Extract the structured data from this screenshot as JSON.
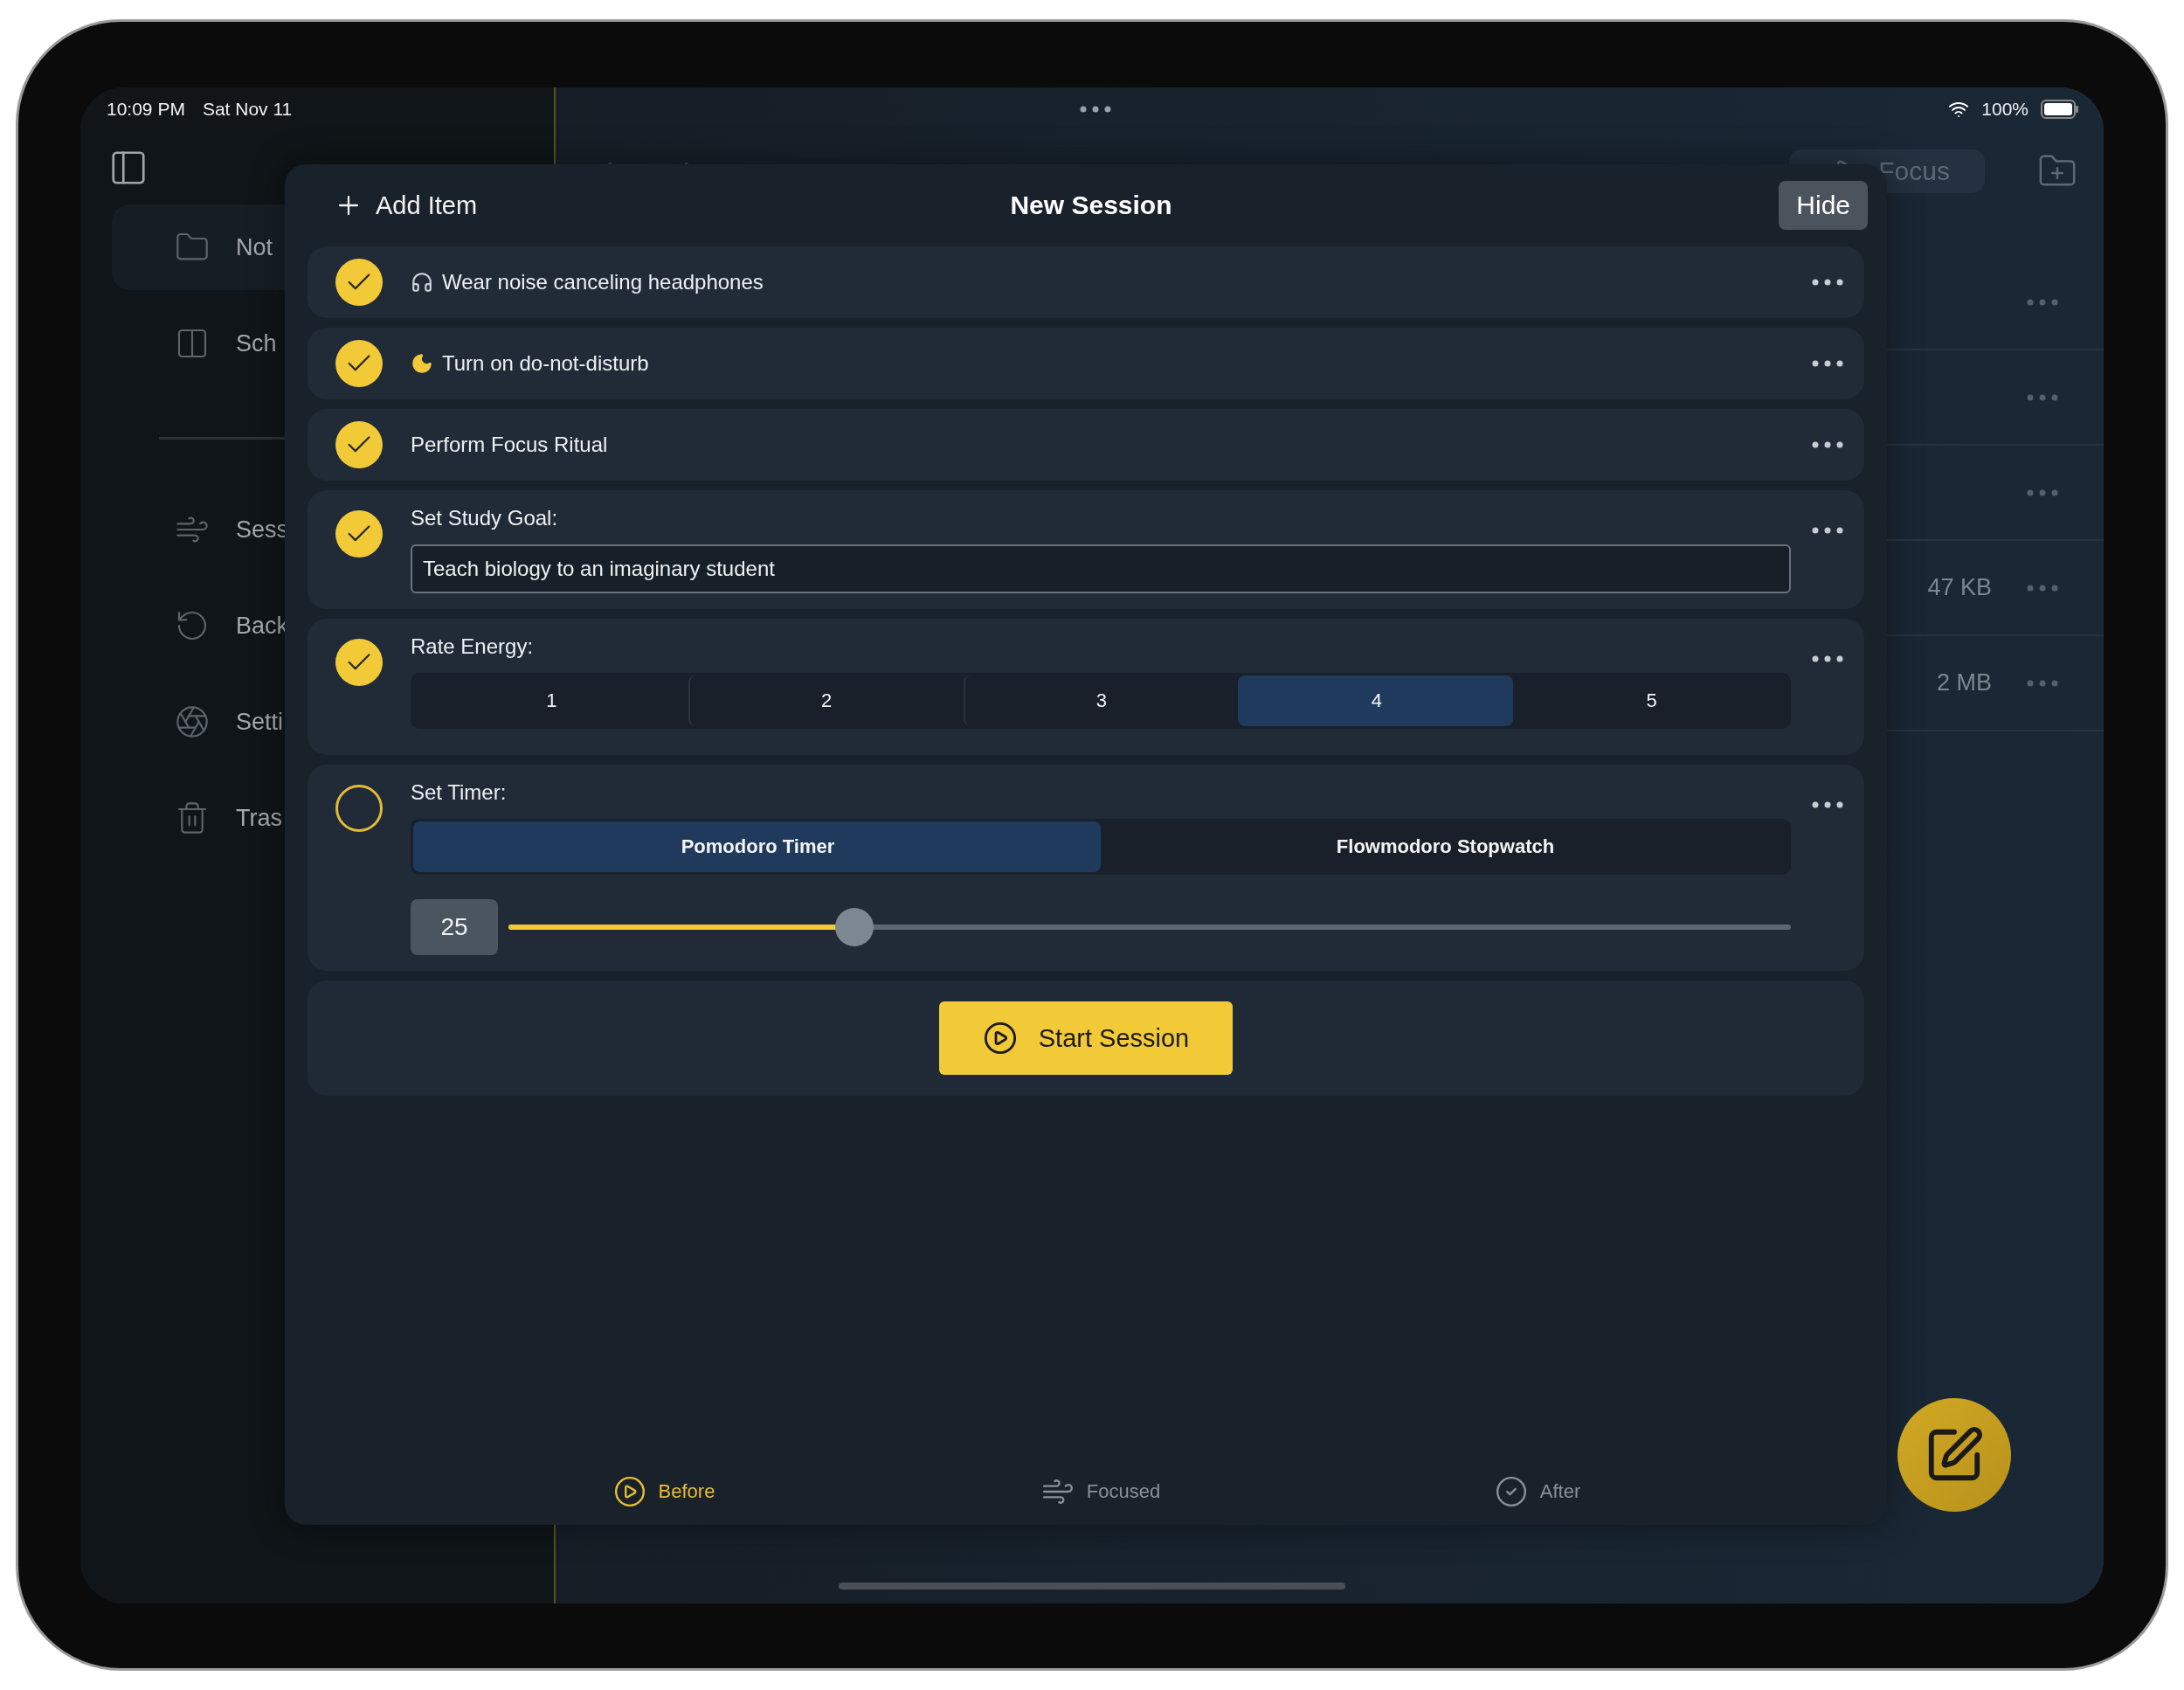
{
  "status_bar": {
    "time": "10:09 PM",
    "date": "Sat Nov 11",
    "battery": "100%"
  },
  "sidebar": {
    "items": [
      {
        "label": "Not",
        "selected": true
      },
      {
        "label": "Sch",
        "selected": false
      },
      {
        "label": "Sess",
        "selected": false
      },
      {
        "label": "Back",
        "selected": false
      },
      {
        "label": "Setti",
        "selected": false
      },
      {
        "label": "Tras",
        "selected": false
      }
    ]
  },
  "toolbar": {
    "focus_button": "Focus"
  },
  "file_list": {
    "rows": [
      {
        "kind": "plain"
      },
      {
        "kind": "plain"
      },
      {
        "kind": "plain"
      },
      {
        "kind": "file",
        "size": "47 KB"
      },
      {
        "kind": "file",
        "size": "2 MB"
      }
    ]
  },
  "sheet": {
    "add_item": "Add Item",
    "title": "New Session",
    "hide": "Hide",
    "items": [
      {
        "kind": "task",
        "checked": true,
        "label": "Wear noise canceling headphones"
      },
      {
        "kind": "task",
        "checked": true,
        "label": "Turn on do-not-disturb"
      },
      {
        "kind": "task",
        "checked": true,
        "label": "Perform Focus Ritual"
      },
      {
        "kind": "text",
        "checked": true,
        "label": "Set Study Goal:",
        "value": "Teach biology to an imaginary student"
      },
      {
        "kind": "rating",
        "checked": true,
        "label": "Rate Energy:",
        "options": [
          {
            "label": "1",
            "selected": false
          },
          {
            "label": "2",
            "selected": false
          },
          {
            "label": "3",
            "selected": false
          },
          {
            "label": "4",
            "selected": true
          },
          {
            "label": "5",
            "selected": false
          }
        ]
      },
      {
        "kind": "timer",
        "checked": false,
        "label": "Set Timer:",
        "modes": [
          {
            "label": "Pomodoro Timer",
            "selected": true
          },
          {
            "label": "Flowmodoro Stopwatch",
            "selected": false
          }
        ],
        "value": "25",
        "level": 0.27
      }
    ],
    "start_button": "Start Session"
  },
  "tab_bar": [
    {
      "label": "Before",
      "selected": true
    },
    {
      "label": "Focused",
      "selected": false
    },
    {
      "label": "After",
      "selected": false
    }
  ]
}
